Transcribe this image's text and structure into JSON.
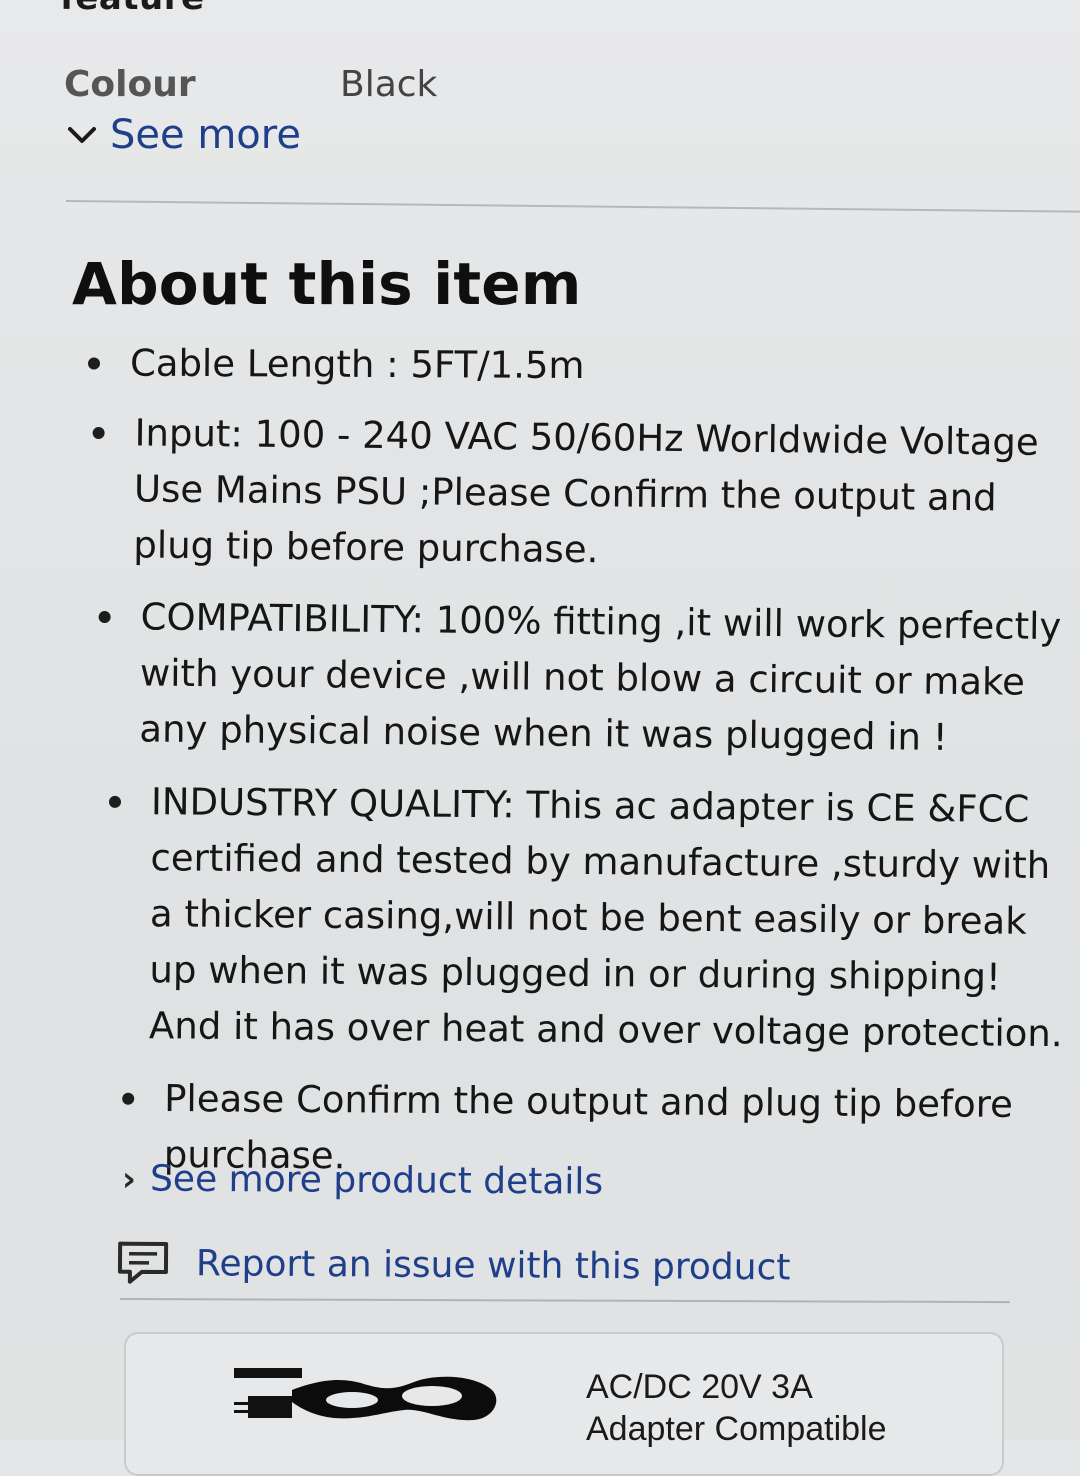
{
  "section_header": {
    "title": "feature"
  },
  "specs": [
    {
      "label": "Colour",
      "value": "Black"
    }
  ],
  "see_more": {
    "label": "See more",
    "icon": "chevron-down-icon"
  },
  "about": {
    "title": "About this item",
    "bullets": [
      "Cable Length : 5FT/1.5m",
      "Input: 100 - 240 VAC 50/60Hz Worldwide Voltage Use Mains PSU ;Please Confirm the output and plug tip before purchase.",
      "COMPATIBILITY: 100% fitting ,it will work perfectly with your device ,will not blow a circuit or make any physical noise when it was plugged in !",
      "INDUSTRY QUALITY: This ac adapter is CE &FCC certified and tested by manufacture ,sturdy with a thicker casing,will not be bent easily or break up when it was plugged in or during shipping! And it has over heat and over voltage protection.",
      "Please Confirm the output and plug tip before purchase."
    ]
  },
  "details_link": {
    "label": "See more product details",
    "icon": "chevron-right-icon"
  },
  "report": {
    "label": "Report an issue with this product",
    "icon": "feedback-icon"
  },
  "product_card": {
    "title_line1": "AC/DC 20V 3A",
    "title_line2": "Adapter Compatible",
    "image": "power-cable-image"
  },
  "colors": {
    "link": "#1f3f8a",
    "text": "#161616",
    "background": "#e2e4e5"
  }
}
